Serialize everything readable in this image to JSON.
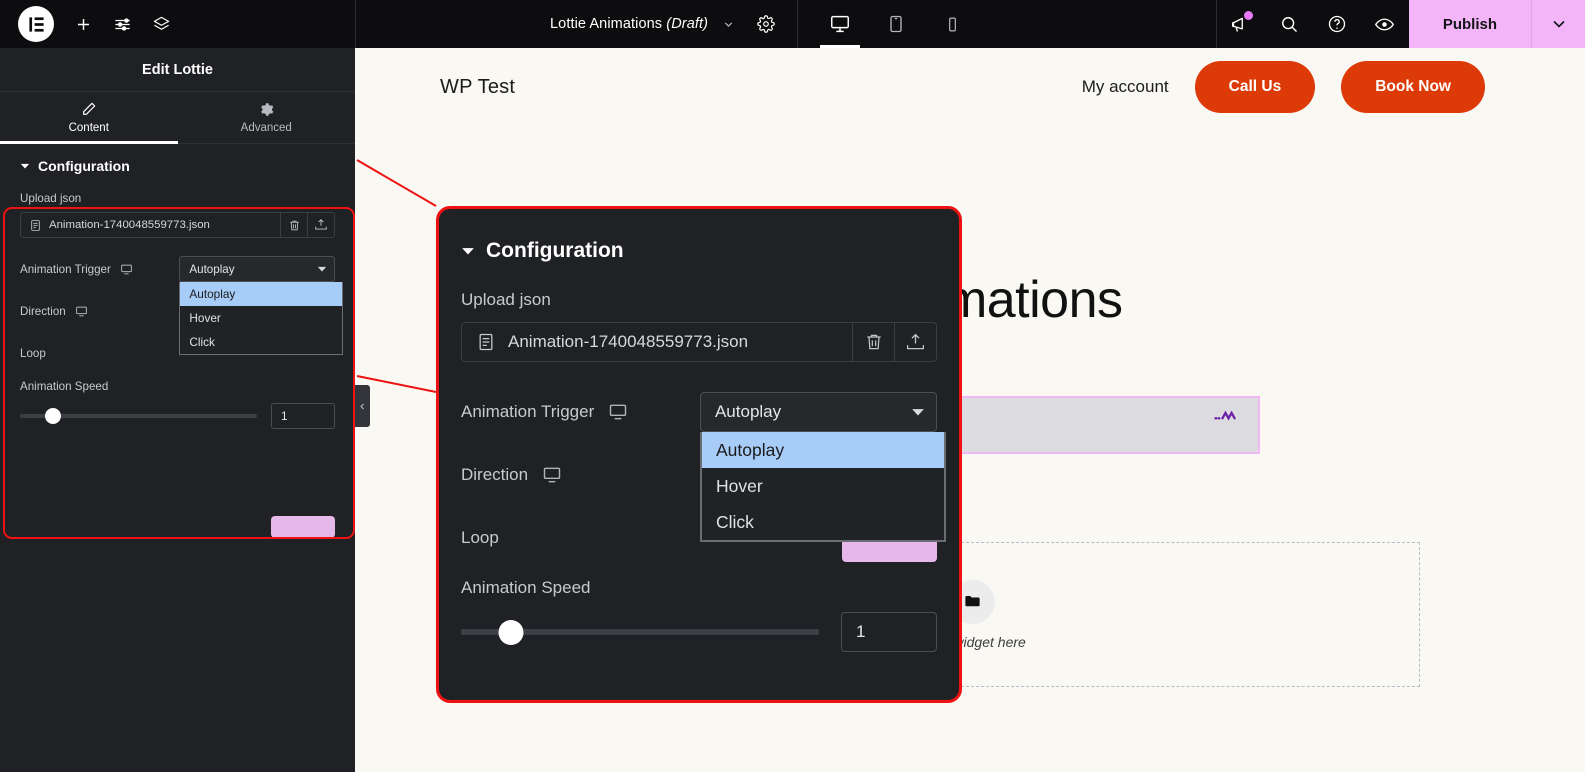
{
  "topbar": {
    "logo_icon": "elementor-logo-icon",
    "add_icon": "plus-icon",
    "settings_icon": "sliders-icon",
    "layers_icon": "layers-icon",
    "document_title": "Lottie Animations",
    "document_status": "(Draft)",
    "document_caret": "chevron-down-icon",
    "page_settings_icon": "gear-icon",
    "devices": [
      {
        "name": "desktop",
        "icon": "desktop-icon",
        "active": true
      },
      {
        "name": "tablet",
        "icon": "tablet-icon",
        "active": false
      },
      {
        "name": "mobile",
        "icon": "mobile-icon",
        "active": false
      }
    ],
    "notifications_icon": "megaphone-icon",
    "search_icon": "search-icon",
    "help_icon": "question-circle-icon",
    "preview_icon": "eye-icon",
    "publish_label": "Publish",
    "publish_caret": "chevron-down-icon",
    "publish_color": "#f3b5f8"
  },
  "panel": {
    "title": "Edit Lottie",
    "tabs": [
      {
        "label": "Content",
        "icon": "pencil-icon",
        "active": true
      },
      {
        "label": "Advanced",
        "icon": "gear-icon",
        "active": false
      }
    ],
    "section": {
      "title": "Configuration",
      "collapse_icon": "caret-down-icon",
      "upload_label": "Upload json",
      "file_name": "Animation-1740048559773.json",
      "file_icon": "file-json-icon",
      "delete_icon": "trash-icon",
      "upload_icon": "upload-cloud-icon",
      "trigger_label": "Animation Trigger",
      "trigger_device_icon": "desktop-icon",
      "trigger_value": "Autoplay",
      "trigger_caret": "caret-down-icon",
      "trigger_options": [
        {
          "label": "Autoplay",
          "selected": true
        },
        {
          "label": "Hover",
          "selected": false
        },
        {
          "label": "Click",
          "selected": false
        }
      ],
      "direction_label": "Direction",
      "direction_device_icon": "desktop-icon",
      "loop_label": "Loop",
      "speed_label": "Animation Speed",
      "speed_value": "1",
      "speed_knob_percent": 14,
      "highlight_color": "#ee1212"
    },
    "collapse_handle_icon": "chevron-left-icon"
  },
  "canvas": {
    "site_logo": "WP Test",
    "nav_link": "My account",
    "cta_primary": "Call Us",
    "cta_secondary": "Book Now",
    "cta_color": "#dc3a06",
    "page_heading": "Lottie Animations",
    "selected_widget_icon": "lottie-squiggle-icon",
    "dropzone_icon": "folder-icon",
    "dropzone_text": "Drag widget here"
  }
}
